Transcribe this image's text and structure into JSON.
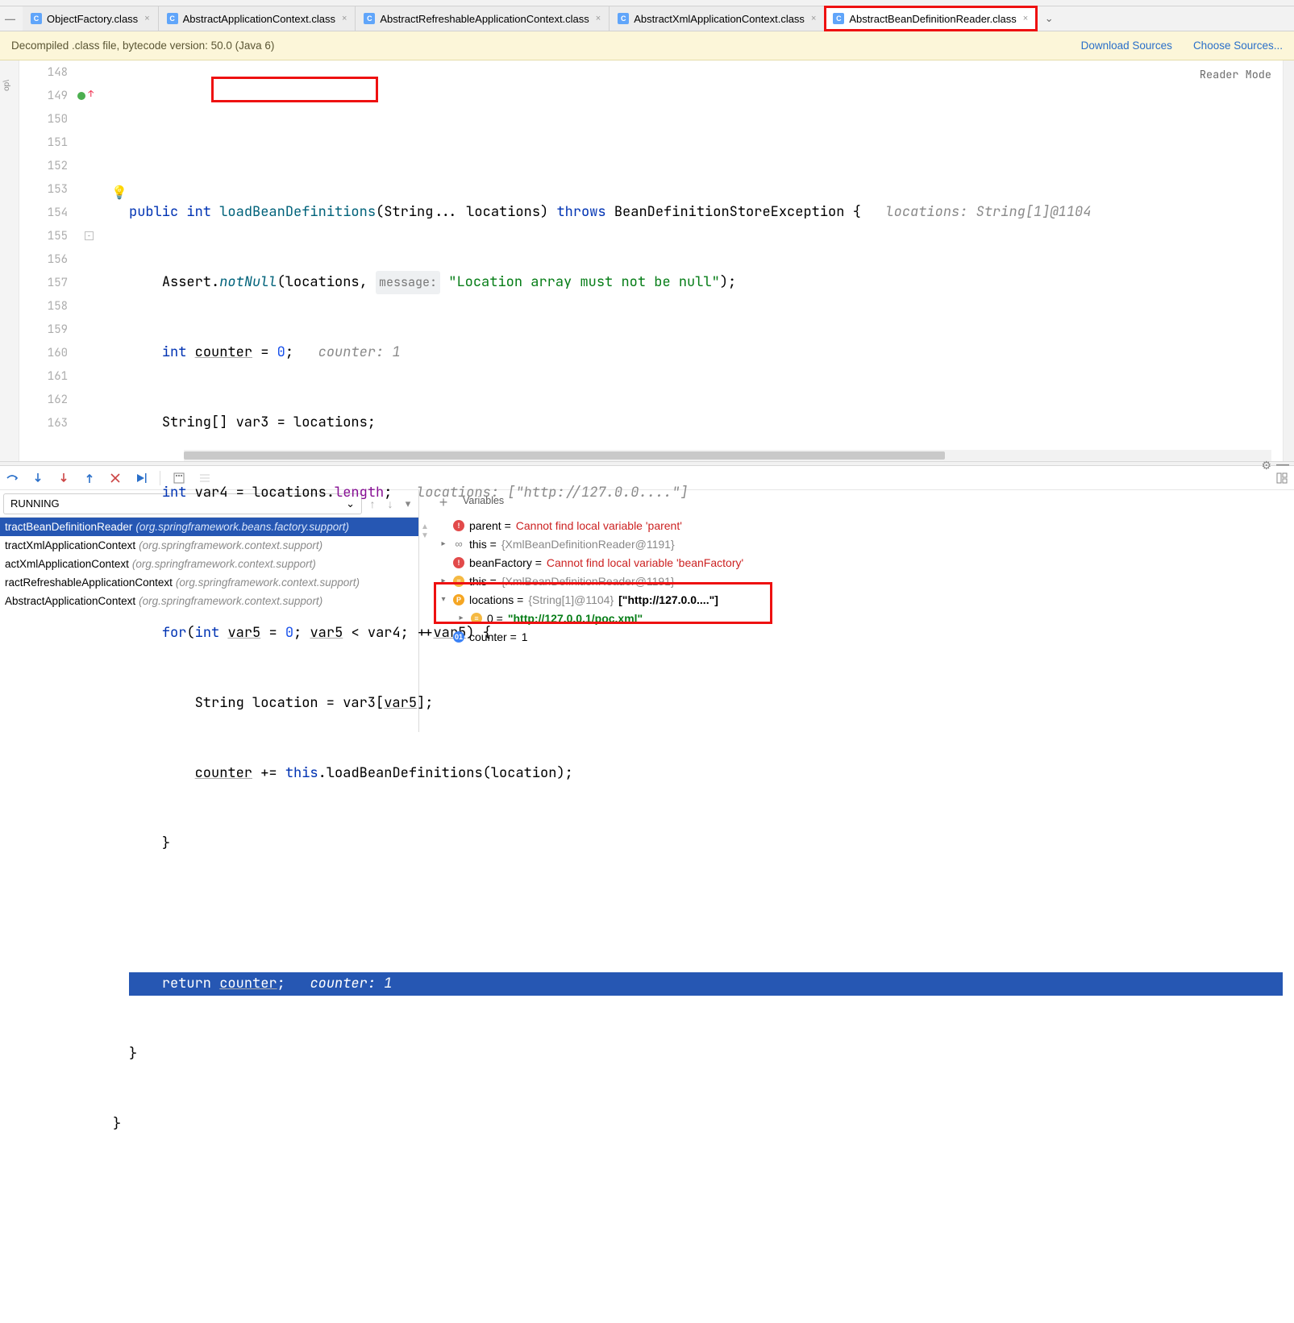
{
  "tabs": [
    {
      "label": "ObjectFactory.class"
    },
    {
      "label": "AbstractApplicationContext.class"
    },
    {
      "label": "AbstractRefreshableApplicationContext.class"
    },
    {
      "label": "AbstractXmlApplicationContext.class"
    },
    {
      "label": "AbstractBeanDefinitionReader.class"
    }
  ],
  "banner": {
    "text": "Decompiled .class file, bytecode version: 50.0 (Java 6)",
    "download": "Download Sources",
    "choose": "Choose Sources..."
  },
  "reader_mode": "Reader Mode",
  "lines": {
    "148": "148",
    "149": "149",
    "150": "150",
    "151": "151",
    "152": "152",
    "153": "153",
    "154": "154",
    "155": "155",
    "156": "156",
    "157": "157",
    "158": "158",
    "159": "159",
    "160": "160",
    "161": "161",
    "162": "162",
    "163": "163"
  },
  "code": {
    "l149": {
      "pub": "public ",
      "int": "int ",
      "fn": "loadBeanDefinitions",
      "sig": "(String... locations) ",
      "throws": "throws ",
      "exc": "BeanDefinitionStoreException {",
      "hint": "locations: String[1]@1104"
    },
    "l150": {
      "a": "Assert.",
      "nn": "notNull",
      "b": "(locations, ",
      "msglabel": "message:",
      "str": " \"Location array must not be null\"",
      "c": ");"
    },
    "l151": {
      "int": "int ",
      "var": "counter",
      "eq": " = ",
      "num": "0",
      "semi": ";",
      "hint": "counter: 1"
    },
    "l152": {
      "t": "String[] var3 = locations;"
    },
    "l153": {
      "int": "int ",
      "t": "var4 = locations.",
      "len": "length",
      "semi": ";",
      "hint": "locations: [\"http://127.0.0....\"]"
    },
    "l155": {
      "for": "for",
      "open": "(",
      "int": "int ",
      "v5a": "var5",
      "eq": " = ",
      "num": "0",
      "semi1": "; ",
      "v5b": "var5",
      "lt": " < var4; ++",
      "v5c": "var5",
      "close": ") {"
    },
    "l156": {
      "t": "String location = var3[",
      "v": "var5",
      "c": "];"
    },
    "l157": {
      "cnt": "counter",
      "t": " += ",
      "this": "this",
      "rest": ".loadBeanDefinitions(location);"
    },
    "l158": {
      "t": "}"
    },
    "l160": {
      "ret": "return ",
      "cnt": "counter",
      "semi": ";",
      "hint": "counter: 1"
    },
    "l161": {
      "t": "}"
    },
    "l162": {
      "t": "}"
    }
  },
  "frames": {
    "status": "RUNNING",
    "list": [
      {
        "main": "tractBeanDefinitionReader ",
        "pkg": "(org.springframework.beans.factory.support)"
      },
      {
        "main": "tractXmlApplicationContext ",
        "pkg": "(org.springframework.context.support)"
      },
      {
        "main": "actXmlApplicationContext ",
        "pkg": "(org.springframework.context.support)"
      },
      {
        "main": "ractRefreshableApplicationContext ",
        "pkg": "(org.springframework.context.support)"
      },
      {
        "main": "AbstractApplicationContext ",
        "pkg": "(org.springframework.context.support)"
      }
    ]
  },
  "vars": {
    "title": "Variables",
    "rows": {
      "parent": {
        "name": "parent = ",
        "val": "Cannot find local variable 'parent'"
      },
      "this1": {
        "name": "this = ",
        "val": "{XmlBeanDefinitionReader@1191}"
      },
      "beanFactory": {
        "name": "beanFactory = ",
        "val": "Cannot find local variable 'beanFactory'"
      },
      "this2": {
        "name": "this = ",
        "val": "{XmlBeanDefinitionReader@1191}"
      },
      "locations": {
        "name": "locations = ",
        "type": "{String[1]@1104} ",
        "val": "[\"http://127.0.0....\"]"
      },
      "loc0": {
        "name": "0 = ",
        "val": "\"http://127.0.0.1/poc.xml\""
      },
      "counter": {
        "name": "counter = ",
        "val": "1"
      }
    }
  }
}
